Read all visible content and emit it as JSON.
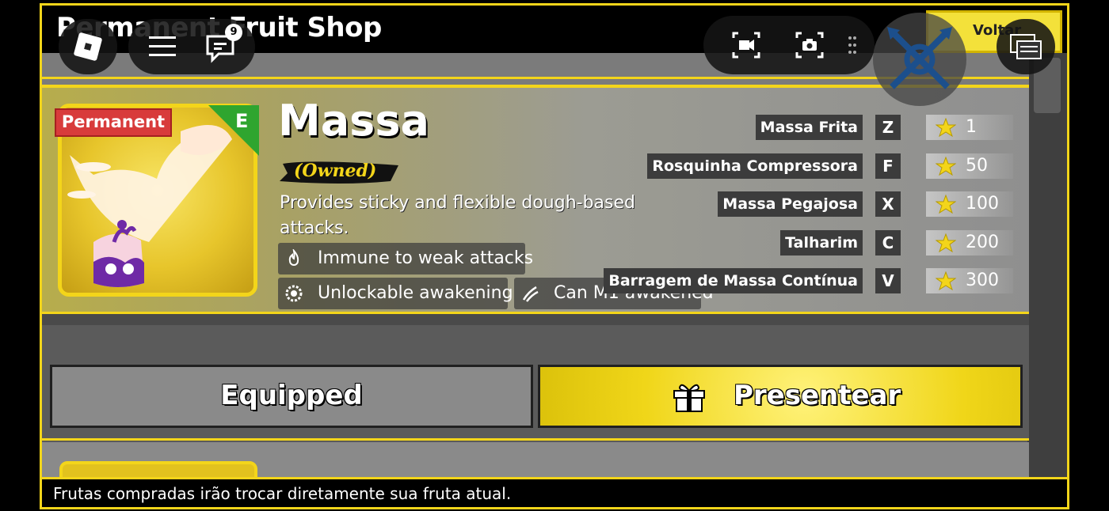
{
  "header": {
    "title": "Permanent Fruit Shop",
    "back_label": "Voltar"
  },
  "roblox_overlay": {
    "notification_count": "9"
  },
  "fruit": {
    "badge": "Permanent",
    "rarity": "E",
    "name": "Massa",
    "owned_label": "(Owned)",
    "description": "Provides sticky and flexible dough-based attacks.",
    "traits": [
      {
        "icon": "flame-icon",
        "label": "Immune to weak attacks"
      },
      {
        "icon": "awakening-icon",
        "label": "Unlockable awakening"
      },
      {
        "icon": "claw-icon",
        "label": "Can M1 awakened"
      }
    ],
    "moves": [
      {
        "name": "Massa Frita",
        "key": "Z",
        "level": "1"
      },
      {
        "name": "Rosquinha Compressora",
        "key": "F",
        "level": "50"
      },
      {
        "name": "Massa Pegajosa",
        "key": "X",
        "level": "100"
      },
      {
        "name": "Talharim",
        "key": "C",
        "level": "200"
      },
      {
        "name": "Barragem de Massa Contínua",
        "key": "V",
        "level": "300"
      }
    ]
  },
  "actions": {
    "equipped_label": "Equipped",
    "gift_label": "Presentear"
  },
  "notice": "Frutas compradas irão trocar diretamente sua fruta atual.",
  "colors": {
    "accent_yellow": "#f3d51a",
    "badge_red": "#d83b3b",
    "rarity_green": "#2fa52f"
  }
}
